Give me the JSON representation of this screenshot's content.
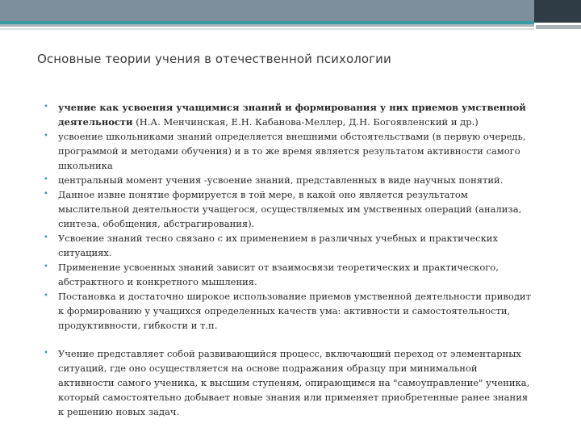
{
  "slide": {
    "title": "Основные теории учения в отечественной психологии",
    "items": [
      {
        "bold": "учение как усвоения учащимися знаний и формирования у них приемов умственной деятельности",
        "text": " (Н.А. Менчинская, Е.Н. Кабанова-Меллер, Д.Н. Богоявленский и др.)"
      },
      {
        "bold": "",
        "text": "усвоение школьниками знаний определяется внешними обстоятельствами (в первую очередь, программой и методами обучения) и в то же время является результатом активности самого школьника"
      },
      {
        "bold": "",
        "text": "центральный момент учения -усвоение знаний, представленных в виде научных понятий."
      },
      {
        "bold": "",
        "text": "Данное извне понятие формируется в той мере, в какой оно является результатом мыслительной деятельности учащегося, осуществляемых им умственных операций (анализа, синтеза, обобщения, абстрагирования)."
      },
      {
        "bold": "",
        "text": "Усвоение знаний тесно связано с их применением в различных учебных и практических ситуациях."
      },
      {
        "bold": "",
        "text": "Применение усвоенных знаний зависит от взаимосвязи теоретических и практического, абстрактного и конкретного мышления."
      },
      {
        "bold": "",
        "text": "Постановка и достаточно широкое использование приемов умственной деятельности приводит к формированию у учащихся определенных качеств ума: активности и самостоятельности, продуктивности, гибкости и т.п."
      },
      {
        "bold": "",
        "text": "Учение представляет собой развивающийся процесс, включающий переход от элементарных ситуаций, где оно осуществляется на основе подражания образцу при минимальной активности самого ученика, к высшим ступеням, опирающимся на \"самоуправление\" ученика, который самостоятельно добывает новые знания или применяет приобретенные ранее знания к решению новых задач."
      }
    ]
  },
  "style": {
    "accent": "#3b9aa2",
    "header_bar": "#7d8f9b",
    "header_dark": "#2f3c45",
    "bullet_glyph": "•"
  }
}
